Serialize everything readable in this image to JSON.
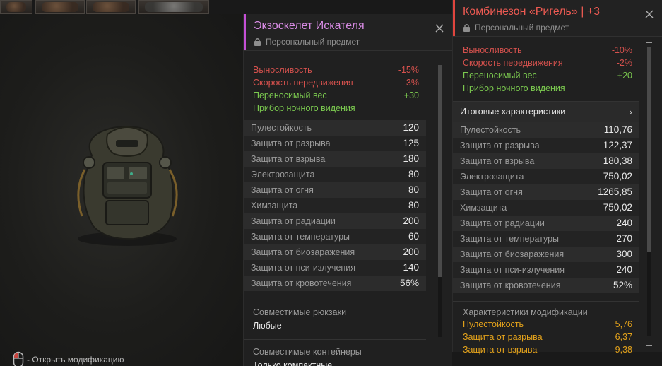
{
  "hint": {
    "text": "- Открыть модификацию"
  },
  "panel1": {
    "title": "Экзоскелет Искателя",
    "subtitle": "Персональный предмет",
    "accent_color": "#c54fd6",
    "bonuses": [
      {
        "label": "Выносливость",
        "value": "-15%",
        "tone": "red"
      },
      {
        "label": "Скорость передвижения",
        "value": "-3%",
        "tone": "red"
      },
      {
        "label": "Переносимый вес",
        "value": "+30",
        "tone": "green"
      },
      {
        "label": "Прибор ночного видения",
        "value": "",
        "tone": "green"
      }
    ],
    "stats": [
      {
        "label": "Пулестойкость",
        "value": "120"
      },
      {
        "label": "Защита от разрыва",
        "value": "125"
      },
      {
        "label": "Защита от взрыва",
        "value": "180"
      },
      {
        "label": "Электрозащита",
        "value": "80"
      },
      {
        "label": "Защита от огня",
        "value": "80"
      },
      {
        "label": "Химзащита",
        "value": "80"
      },
      {
        "label": "Защита от радиации",
        "value": "200"
      },
      {
        "label": "Защита от температуры",
        "value": "60"
      },
      {
        "label": "Защита от биозаражения",
        "value": "200"
      },
      {
        "label": "Защита от пси-излучения",
        "value": "140"
      },
      {
        "label": "Защита от кровотечения",
        "value": "56%"
      }
    ],
    "backpacks_label": "Совместимые рюкзаки",
    "backpacks_value": "Любые",
    "containers_label": "Совместимые контейнеры",
    "containers_value": "Только компактные"
  },
  "panel2": {
    "title": "Комбинезон «Ригель» | +3",
    "subtitle": "Персональный предмет",
    "accent_color": "#e0453e",
    "bonuses": [
      {
        "label": "Выносливость",
        "value": "-10%",
        "tone": "red"
      },
      {
        "label": "Скорость передвижения",
        "value": "-2%",
        "tone": "red"
      },
      {
        "label": "Переносимый вес",
        "value": "+20",
        "tone": "green"
      },
      {
        "label": "Прибор ночного видения",
        "value": "",
        "tone": "green"
      }
    ],
    "summary_label": "Итоговые характеристики",
    "stats": [
      {
        "label": "Пулестойкость",
        "value": "110,76"
      },
      {
        "label": "Защита от разрыва",
        "value": "122,37"
      },
      {
        "label": "Защита от взрыва",
        "value": "180,38"
      },
      {
        "label": "Электрозащита",
        "value": "750,02"
      },
      {
        "label": "Защита от огня",
        "value": "1265,85"
      },
      {
        "label": "Химзащита",
        "value": "750,02"
      },
      {
        "label": "Защита от радиации",
        "value": "240"
      },
      {
        "label": "Защита от температуры",
        "value": "270"
      },
      {
        "label": "Защита от биозаражения",
        "value": "300"
      },
      {
        "label": "Защита от пси-излучения",
        "value": "240"
      },
      {
        "label": "Защита от кровотечения",
        "value": "52%"
      }
    ],
    "mod_title": "Характеристики модификации",
    "mod_stats": [
      {
        "label": "Пулестойкость",
        "value": "5,76"
      },
      {
        "label": "Защита от разрыва",
        "value": "6,37"
      },
      {
        "label": "Защита от взрыва",
        "value": "9,38"
      }
    ]
  },
  "colors": {
    "red": "#d5514d",
    "green": "#7bc94f",
    "orange": "#e3a21b",
    "background": "#191919"
  },
  "icons": {
    "mouse": "mouse-left-click-icon",
    "lock": "lock-icon",
    "close": "close-icon",
    "chevron": "chevron-right-icon"
  }
}
